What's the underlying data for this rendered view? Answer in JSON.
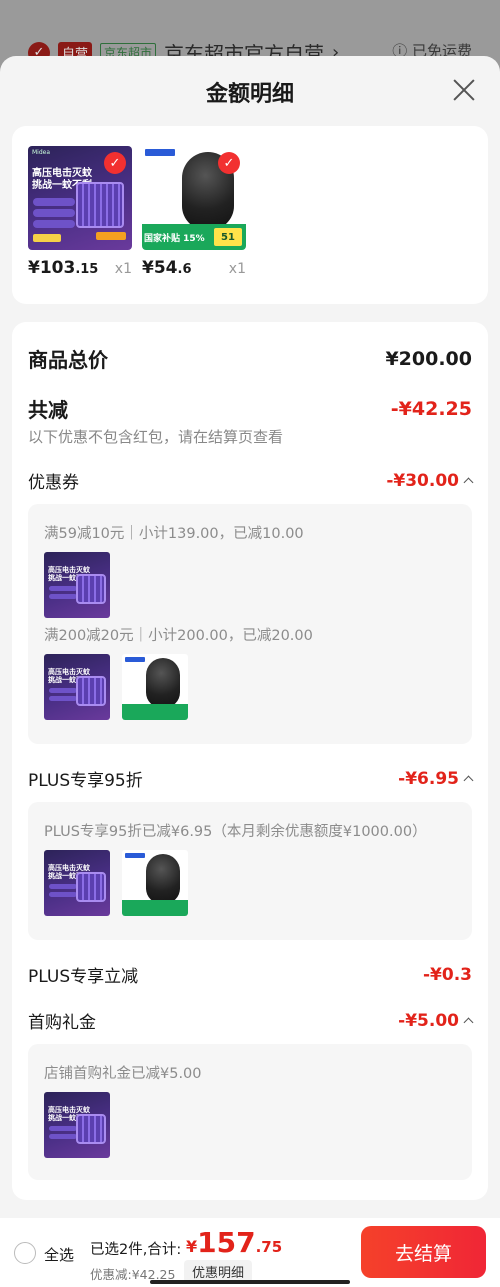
{
  "background": {
    "self_run_tag": "自营",
    "jd_tag": "京东超市",
    "store_name": "京东超市官方自营",
    "free_shipping": "已免运费"
  },
  "sheet": {
    "title": "金额明细"
  },
  "products": [
    {
      "price_int": "¥103",
      "price_dec": ".15",
      "qty": "x1",
      "img_headline_1": "高压电击灭蚊",
      "img_headline_2": "挑战一蚊不剩"
    },
    {
      "price_int": "¥54",
      "price_dec": ".6",
      "qty": "x1",
      "img_tag": "国家补贴",
      "img_pct": "15%",
      "img_price": "51"
    }
  ],
  "summary": {
    "goods_total_label": "商品总价",
    "goods_total_value": "¥200.00",
    "total_discount_label": "共减",
    "total_discount_value": "-¥42.25",
    "note": "以下优惠不包含红包，请在结算页查看",
    "coupon_label": "优惠券",
    "coupon_value": "-¥30.00",
    "coupon_rule_1": "满59减10元｜小计139.00，已减10.00",
    "coupon_rule_2": "满200减20元｜小计200.00，已减20.00",
    "plus_discount_label": "PLUS专享95折",
    "plus_discount_value": "-¥6.95",
    "plus_discount_detail": "PLUS专享95折已减¥6.95（本月剩余优惠额度¥1000.00）",
    "plus_instant_label": "PLUS专享立减",
    "plus_instant_value": "-¥0.3",
    "first_gift_label": "首购礼金",
    "first_gift_value": "-¥5.00",
    "first_gift_detail": "店铺首购礼金已减¥5.00"
  },
  "bottom": {
    "select_all": "全选",
    "selected_count": "已选2件,合计:",
    "total_currency": "¥",
    "total_int": "157",
    "total_dec": ".75",
    "saved": "优惠减:¥42.25",
    "detail_button": "优惠明细",
    "checkout_button": "去结算"
  },
  "colors": {
    "accent_red": "#e2231a",
    "checkout_red": "#f5412a"
  }
}
